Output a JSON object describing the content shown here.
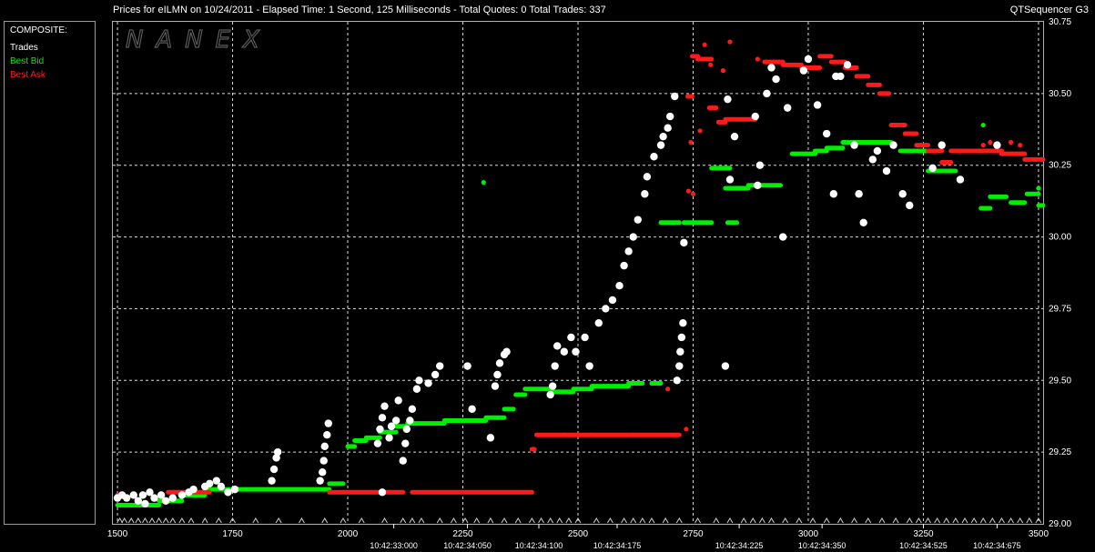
{
  "header": {
    "title": "Prices for  eILMN  on  10/24/2011  -  Elapsed Time: 1 Second, 125 Milliseconds  -  Total Quotes: 0  Total Trades: 337",
    "app_name": "QTSequencer G3"
  },
  "watermark": "NANEX",
  "legend": {
    "title": "COMPOSITE:",
    "items": [
      {
        "label": "Trades",
        "color": "#ffffff"
      },
      {
        "label": "Best Bid",
        "color": "#00ee00"
      },
      {
        "label": "Best Ask",
        "color": "#ff1a1a"
      }
    ]
  },
  "colors": {
    "trades": "#ffffff",
    "bid": "#00ee00",
    "ask": "#ff1a1a",
    "grid": "#d8d8d8",
    "background": "#000000"
  },
  "chart_data": {
    "type": "scatter",
    "title": "Prices for  eILMN  on  10/24/2011",
    "xlabel": "",
    "ylabel": "",
    "xlim": [
      1490,
      3510
    ],
    "ylim": [
      29.0,
      30.75
    ],
    "x_ticks": [
      1500,
      1750,
      2000,
      2250,
      2500,
      2750,
      3000,
      3250,
      3500
    ],
    "y_ticks": [
      29.0,
      29.25,
      29.5,
      29.75,
      30.0,
      30.25,
      30.5,
      30.75
    ],
    "y_tick_labels": [
      "29.00",
      "29.25",
      "29.50",
      "29.75",
      "30.00",
      "30.25",
      "30.50",
      "30.75"
    ],
    "time_labels": [
      {
        "x": 2100,
        "label": "10:42:33:000"
      },
      {
        "x": 2260,
        "label": "10:42:34:050"
      },
      {
        "x": 2415,
        "label": "10:42:34:100"
      },
      {
        "x": 2585,
        "label": "10:42:34:175"
      },
      {
        "x": 2850,
        "label": "10:42:34:225"
      },
      {
        "x": 3030,
        "label": "10:42:34:350"
      },
      {
        "x": 3250,
        "label": "10:42:34:525"
      },
      {
        "x": 3410,
        "label": "10:42:34:675"
      }
    ],
    "grid": true,
    "legend": "top-left",
    "series": [
      {
        "name": "Best Bid",
        "color": "#00ee00",
        "steps": [
          [
            1500,
            1590,
            29.065
          ],
          [
            1590,
            1640,
            29.08
          ],
          [
            1640,
            1690,
            29.1
          ],
          [
            1690,
            1960,
            29.12
          ],
          [
            1960,
            1990,
            29.14
          ],
          [
            2000,
            2015,
            29.27
          ],
          [
            2015,
            2040,
            29.29
          ],
          [
            2040,
            2070,
            29.3
          ],
          [
            2070,
            2105,
            29.32
          ],
          [
            2105,
            2130,
            29.34
          ],
          [
            2130,
            2210,
            29.35
          ],
          [
            2210,
            2300,
            29.36
          ],
          [
            2300,
            2340,
            29.37
          ],
          [
            2340,
            2360,
            29.4
          ],
          [
            2365,
            2385,
            29.45
          ],
          [
            2385,
            2440,
            29.47
          ],
          [
            2440,
            2490,
            29.46
          ],
          [
            2490,
            2530,
            29.47
          ],
          [
            2530,
            2610,
            29.48
          ],
          [
            2610,
            2640,
            29.49
          ],
          [
            2660,
            2680,
            29.49
          ],
          [
            2680,
            2720,
            30.05
          ],
          [
            2730,
            2790,
            30.05
          ],
          [
            2825,
            2845,
            30.05
          ],
          [
            2790,
            2830,
            30.24
          ],
          [
            2820,
            2870,
            30.17
          ],
          [
            2870,
            2940,
            30.18
          ],
          [
            2965,
            3015,
            30.29
          ],
          [
            3015,
            3040,
            30.3
          ],
          [
            3040,
            3075,
            30.31
          ],
          [
            3075,
            3100,
            30.33
          ],
          [
            3100,
            3180,
            30.33
          ],
          [
            3200,
            3260,
            30.3
          ],
          [
            3260,
            3320,
            30.23
          ],
          [
            3375,
            3395,
            30.1
          ],
          [
            3395,
            3430,
            30.14
          ],
          [
            3440,
            3470,
            30.12
          ],
          [
            3475,
            3500,
            30.15
          ],
          [
            3500,
            3510,
            30.11
          ]
        ],
        "points": [
          [
            2295,
            30.19
          ],
          [
            3380,
            30.39
          ],
          [
            3500,
            30.17
          ]
        ]
      },
      {
        "name": "Best Ask",
        "color": "#ff1a1a",
        "steps": [
          [
            1500,
            1510,
            29.1
          ],
          [
            1610,
            1700,
            29.11
          ],
          [
            1960,
            2120,
            29.11
          ],
          [
            2140,
            2400,
            29.11
          ],
          [
            2400,
            2405,
            29.26
          ],
          [
            2410,
            2470,
            29.31
          ],
          [
            2470,
            2530,
            29.31
          ],
          [
            2530,
            2620,
            29.31
          ],
          [
            2620,
            2720,
            29.31
          ],
          [
            2738,
            2748,
            30.49
          ],
          [
            2748,
            2760,
            30.63
          ],
          [
            2760,
            2790,
            30.62
          ],
          [
            2785,
            2800,
            30.45
          ],
          [
            2805,
            2820,
            30.4
          ],
          [
            2820,
            2885,
            30.41
          ],
          [
            2905,
            2945,
            30.61
          ],
          [
            2945,
            2985,
            30.6
          ],
          [
            2985,
            3025,
            30.59
          ],
          [
            3025,
            3050,
            30.63
          ],
          [
            3050,
            3080,
            30.61
          ],
          [
            3080,
            3105,
            30.59
          ],
          [
            3105,
            3130,
            30.56
          ],
          [
            3130,
            3155,
            30.53
          ],
          [
            3155,
            3175,
            30.5
          ],
          [
            3180,
            3210,
            30.39
          ],
          [
            3210,
            3235,
            30.36
          ],
          [
            3235,
            3260,
            30.32
          ],
          [
            3260,
            3290,
            30.3
          ],
          [
            3290,
            3310,
            30.26
          ],
          [
            3310,
            3360,
            30.3
          ],
          [
            3360,
            3420,
            30.3
          ],
          [
            3420,
            3470,
            30.29
          ],
          [
            3470,
            3510,
            30.27
          ]
        ],
        "points": [
          [
            2695,
            29.47
          ],
          [
            2735,
            29.33
          ],
          [
            2740,
            30.16
          ],
          [
            2750,
            30.15
          ],
          [
            2745,
            30.33
          ],
          [
            2765,
            30.37
          ],
          [
            2775,
            30.67
          ],
          [
            2788,
            30.6
          ],
          [
            2815,
            30.58
          ],
          [
            2830,
            30.68
          ],
          [
            2890,
            30.62
          ],
          [
            3380,
            30.32
          ],
          [
            3395,
            30.33
          ],
          [
            3440,
            30.33
          ],
          [
            3460,
            30.32
          ]
        ]
      },
      {
        "name": "Trades",
        "color": "#ffffff",
        "points": [
          [
            1500,
            29.09
          ],
          [
            1510,
            29.1
          ],
          [
            1520,
            29.09
          ],
          [
            1535,
            29.1
          ],
          [
            1545,
            29.08
          ],
          [
            1555,
            29.1
          ],
          [
            1560,
            29.07
          ],
          [
            1570,
            29.11
          ],
          [
            1580,
            29.09
          ],
          [
            1595,
            29.1
          ],
          [
            1605,
            29.08
          ],
          [
            1620,
            29.09
          ],
          [
            1640,
            29.1
          ],
          [
            1655,
            29.11
          ],
          [
            1665,
            29.12
          ],
          [
            1690,
            29.13
          ],
          [
            1700,
            29.14
          ],
          [
            1715,
            29.15
          ],
          [
            1725,
            29.13
          ],
          [
            1740,
            29.11
          ],
          [
            1755,
            29.12
          ],
          [
            1835,
            29.15
          ],
          [
            1840,
            29.19
          ],
          [
            1845,
            29.23
          ],
          [
            1848,
            29.25
          ],
          [
            1940,
            29.15
          ],
          [
            1945,
            29.18
          ],
          [
            1948,
            29.22
          ],
          [
            1950,
            29.27
          ],
          [
            1955,
            29.31
          ],
          [
            1958,
            29.35
          ],
          [
            2075,
            29.11
          ],
          [
            2065,
            29.28
          ],
          [
            2070,
            29.33
          ],
          [
            2075,
            29.37
          ],
          [
            2080,
            29.41
          ],
          [
            2090,
            29.3
          ],
          [
            2095,
            29.34
          ],
          [
            2105,
            29.36
          ],
          [
            2110,
            29.43
          ],
          [
            2120,
            29.22
          ],
          [
            2125,
            29.28
          ],
          [
            2128,
            29.33
          ],
          [
            2135,
            29.36
          ],
          [
            2140,
            29.4
          ],
          [
            2150,
            29.47
          ],
          [
            2155,
            29.5
          ],
          [
            2175,
            29.49
          ],
          [
            2190,
            29.52
          ],
          [
            2200,
            29.55
          ],
          [
            2270,
            29.4
          ],
          [
            2260,
            29.55
          ],
          [
            2310,
            29.3
          ],
          [
            2320,
            29.48
          ],
          [
            2325,
            29.52
          ],
          [
            2330,
            29.56
          ],
          [
            2340,
            29.59
          ],
          [
            2345,
            29.6
          ],
          [
            2440,
            29.45
          ],
          [
            2445,
            29.48
          ],
          [
            2450,
            29.55
          ],
          [
            2455,
            29.62
          ],
          [
            2470,
            29.6
          ],
          [
            2485,
            29.65
          ],
          [
            2495,
            29.6
          ],
          [
            2515,
            29.65
          ],
          [
            2525,
            29.55
          ],
          [
            2545,
            29.7
          ],
          [
            2560,
            29.75
          ],
          [
            2575,
            29.78
          ],
          [
            2590,
            29.83
          ],
          [
            2600,
            29.9
          ],
          [
            2610,
            29.95
          ],
          [
            2620,
            30.0
          ],
          [
            2630,
            30.06
          ],
          [
            2645,
            30.15
          ],
          [
            2650,
            30.21
          ],
          [
            2665,
            30.28
          ],
          [
            2680,
            30.32
          ],
          [
            2685,
            30.35
          ],
          [
            2695,
            30.38
          ],
          [
            2700,
            30.42
          ],
          [
            2710,
            30.49
          ],
          [
            2715,
            29.5
          ],
          [
            2720,
            29.55
          ],
          [
            2722,
            29.6
          ],
          [
            2725,
            29.65
          ],
          [
            2728,
            29.7
          ],
          [
            2730,
            29.98
          ],
          [
            2825,
            30.48
          ],
          [
            2830,
            30.2
          ],
          [
            2840,
            30.35
          ],
          [
            2820,
            29.55
          ],
          [
            2885,
            30.42
          ],
          [
            2890,
            30.18
          ],
          [
            2895,
            30.25
          ],
          [
            2910,
            30.5
          ],
          [
            2920,
            30.59
          ],
          [
            2930,
            30.55
          ],
          [
            2945,
            30.0
          ],
          [
            2955,
            30.45
          ],
          [
            2990,
            30.58
          ],
          [
            3000,
            30.62
          ],
          [
            3020,
            30.46
          ],
          [
            3040,
            30.36
          ],
          [
            3055,
            30.15
          ],
          [
            3060,
            30.56
          ],
          [
            3070,
            30.56
          ],
          [
            3085,
            30.6
          ],
          [
            3100,
            30.32
          ],
          [
            3110,
            30.15
          ],
          [
            3120,
            30.05
          ],
          [
            3140,
            30.27
          ],
          [
            3150,
            30.3
          ],
          [
            3170,
            30.23
          ],
          [
            3185,
            30.32
          ],
          [
            3205,
            30.15
          ],
          [
            3220,
            30.11
          ],
          [
            3270,
            30.24
          ],
          [
            3290,
            30.32
          ],
          [
            3330,
            30.2
          ],
          [
            3410,
            30.32
          ]
        ]
      }
    ]
  }
}
